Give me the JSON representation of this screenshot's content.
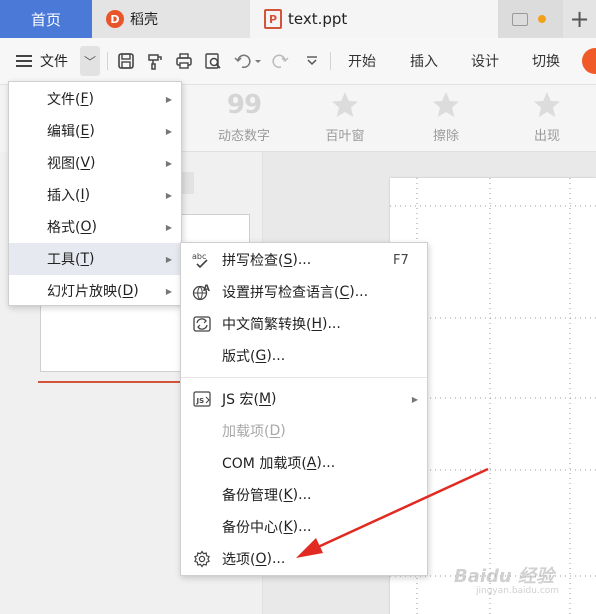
{
  "tabs": {
    "home": "首页",
    "daoke": "稻壳",
    "daoke_logo": "D",
    "file": "text.ppt",
    "file_logo": "P",
    "new_tab": "+"
  },
  "toolbar": {
    "menu_label": "文件",
    "chevron": "﹀",
    "ribbon_tabs": [
      "开始",
      "插入",
      "设计",
      "切换"
    ]
  },
  "animations": [
    {
      "label": "动态数字",
      "icon": "99"
    },
    {
      "label": "百叶窗",
      "icon": "star-icon"
    },
    {
      "label": "擦除",
      "icon": "star-icon"
    },
    {
      "label": "出现",
      "icon": "star-icon"
    }
  ],
  "main_menu": [
    {
      "label": "文件(F)",
      "text": "文件(",
      "key": "F",
      "end": ")"
    },
    {
      "label": "编辑(E)",
      "text": "编辑(",
      "key": "E",
      "end": ")"
    },
    {
      "label": "视图(V)",
      "text": "视图(",
      "key": "V",
      "end": ")"
    },
    {
      "label": "插入(I)",
      "text": "插入(",
      "key": "I",
      "end": ")"
    },
    {
      "label": "格式(O)",
      "text": "格式(",
      "key": "O",
      "end": ")"
    },
    {
      "label": "工具(T)",
      "text": "工具(",
      "key": "T",
      "end": ")",
      "active": true
    },
    {
      "label": "幻灯片放映(D)",
      "text": "幻灯片放映(",
      "key": "D",
      "end": ")"
    }
  ],
  "tools_menu": [
    {
      "text": "拼写检查(",
      "key": "S",
      "end": ")...",
      "shortcut": "F7",
      "icon": "spellcheck-icon"
    },
    {
      "text": "设置拼写检查语言(",
      "key": "C",
      "end": ")...",
      "icon": "language-icon"
    },
    {
      "text": "中文简繁转换(",
      "key": "H",
      "end": ")...",
      "icon": "convert-icon"
    },
    {
      "text": "版式(",
      "key": "G",
      "end": ")..."
    },
    {
      "text": "JS 宏(",
      "key": "M",
      "end": ")",
      "icon": "js-macro-icon",
      "submenu": true
    },
    {
      "text": "加载项(",
      "key": "D",
      "end": ")",
      "disabled": true
    },
    {
      "text": "COM 加载项(",
      "key": "A",
      "end": ")..."
    },
    {
      "text": "备份管理(",
      "key": "K",
      "end": ")..."
    },
    {
      "text": "备份中心(",
      "key": "K",
      "end": ")..."
    },
    {
      "text": "选项(",
      "key": "O",
      "end": ")...",
      "icon": "gear-icon"
    }
  ],
  "watermark": {
    "main": "Baidu 经验",
    "sub": "jingyan.baidu.com"
  },
  "colors": {
    "accent_blue": "#4a79d8",
    "wps_red": "#d2543a",
    "arrow_red": "#e02a22"
  }
}
